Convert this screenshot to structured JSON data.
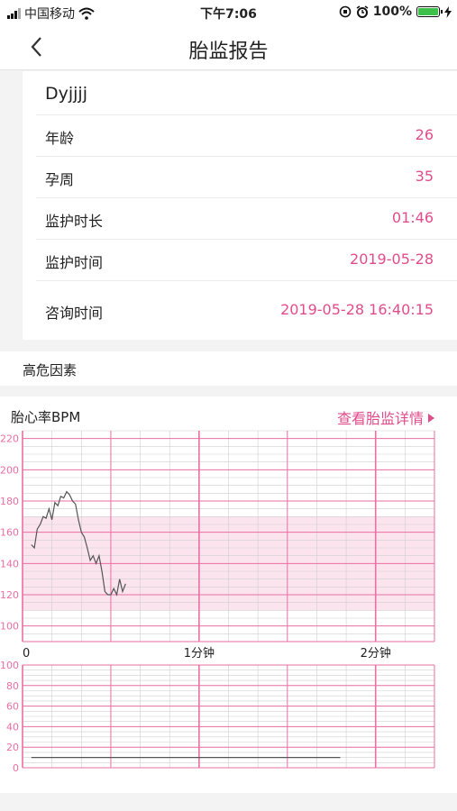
{
  "status": {
    "carrier": "中国移动",
    "time": "下午7:06",
    "battery": "100%"
  },
  "nav": {
    "title": "胎监报告"
  },
  "patient": {
    "name": "Dyjjjj",
    "rows": [
      {
        "label": "年龄",
        "value": "26"
      },
      {
        "label": "孕周",
        "value": "35"
      },
      {
        "label": "监护时长",
        "value": "01:46"
      },
      {
        "label": "监护时间",
        "value": "2019-05-28"
      },
      {
        "label": "咨询时间",
        "value": "2019-05-28 16:40:15"
      }
    ]
  },
  "risk": {
    "label": "高危因素"
  },
  "chart": {
    "title": "胎心率BPM",
    "link": "查看胎监详情"
  },
  "chart_data": [
    {
      "type": "line",
      "title": "胎心率BPM",
      "xlabel": "",
      "ylabel": "",
      "x_ticks": [
        "0",
        "1分钟",
        "2分钟"
      ],
      "x_max_seconds": 140,
      "ylim": [
        90,
        225
      ],
      "y_ticks": [
        100,
        120,
        140,
        160,
        180,
        200,
        220
      ],
      "normal_band": [
        110,
        170
      ],
      "series": [
        {
          "x": [
            3,
            4,
            5,
            6,
            7,
            8,
            9,
            10,
            11,
            12,
            13,
            14,
            15,
            16,
            17,
            18,
            19,
            20,
            21,
            22,
            23,
            24,
            25,
            26,
            27,
            28,
            29,
            30,
            31,
            32,
            33,
            34,
            35
          ],
          "values": [
            152,
            150,
            162,
            165,
            170,
            169,
            175,
            168,
            179,
            177,
            183,
            182,
            186,
            184,
            180,
            178,
            168,
            160,
            157,
            150,
            142,
            145,
            140,
            145,
            135,
            122,
            120,
            120,
            124,
            120,
            130,
            122,
            127
          ]
        }
      ],
      "grid": true,
      "colors": {
        "major": "#ea6fa4",
        "minor": "#cfcfcf",
        "band": "#fbe4ee",
        "line": "#555555"
      }
    },
    {
      "type": "line",
      "xlabel": "",
      "ylabel": "",
      "x_max_seconds": 140,
      "ylim": [
        0,
        100
      ],
      "y_ticks": [
        0,
        20,
        40,
        60,
        80,
        100
      ],
      "series": [
        {
          "x": [
            3,
            108
          ],
          "values": [
            10,
            10
          ]
        }
      ],
      "grid": true
    }
  ]
}
